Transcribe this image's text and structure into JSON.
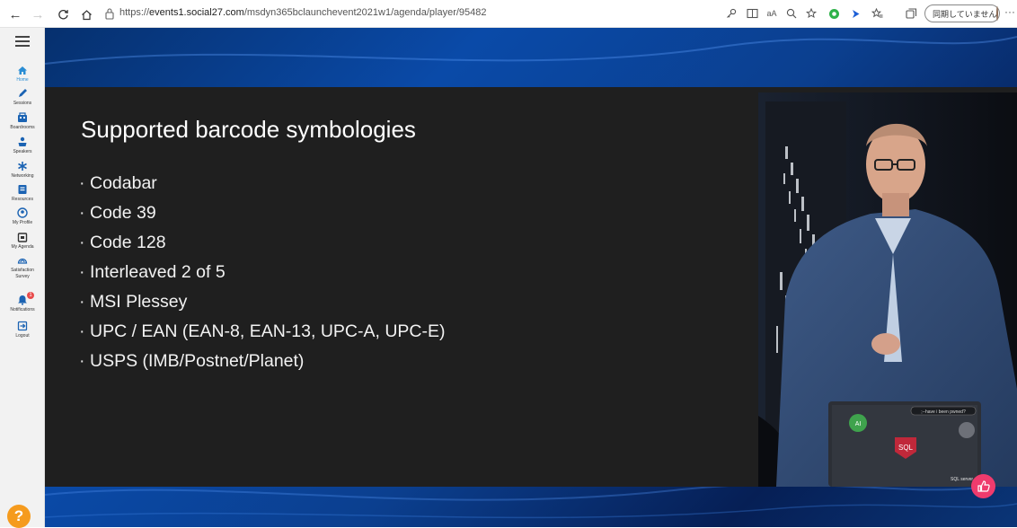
{
  "browser": {
    "url_prefix": "https://",
    "url_host": "events1.social27.com",
    "url_path": "/msdyn365bclaunchevent2021w1/agenda/player/95482",
    "profile_status": "同期していません",
    "more": "···"
  },
  "sidebar": {
    "items": [
      {
        "label": "Home",
        "icon": "home-icon"
      },
      {
        "label": "Sessions",
        "icon": "pen-icon"
      },
      {
        "label": "Boardrooms",
        "icon": "boardroom-icon"
      },
      {
        "label": "Speakers",
        "icon": "speaker-icon"
      },
      {
        "label": "Networking",
        "icon": "networking-icon"
      },
      {
        "label": "Resources",
        "icon": "resources-icon"
      },
      {
        "label": "My Profile",
        "icon": "profile-icon"
      },
      {
        "label": "My Agenda",
        "icon": "agenda-icon"
      },
      {
        "label": "Satisfaction",
        "label2": "Survey",
        "icon": "survey-icon"
      },
      {
        "label": "Notifications",
        "icon": "notification-icon",
        "badge": "1"
      },
      {
        "label": "Logout",
        "icon": "logout-icon"
      }
    ],
    "help": "?"
  },
  "slide": {
    "title": "Supported barcode symbologies",
    "bullet_symbol": "·",
    "bullets": [
      "Codabar",
      "Code 39",
      "Code 128",
      "Interleaved 2 of 5",
      "MSI Plessey",
      "UPC / EAN (EAN-8, EAN-13, UPC-A, UPC-E)",
      "USPS (IMB/Postnet/Planet)"
    ]
  },
  "speaker_video": {
    "laptop_sticker": "SQL",
    "laptop_sticker_2": "SQL server",
    "laptop_sticker_3": ";--have i been pwned?",
    "laptop_sticker_4": "AI"
  },
  "colors": {
    "accent": "#2a8dd4",
    "like": "#ef3b6d",
    "help": "#f59b1e",
    "slide_bg": "#1f1f1f"
  }
}
